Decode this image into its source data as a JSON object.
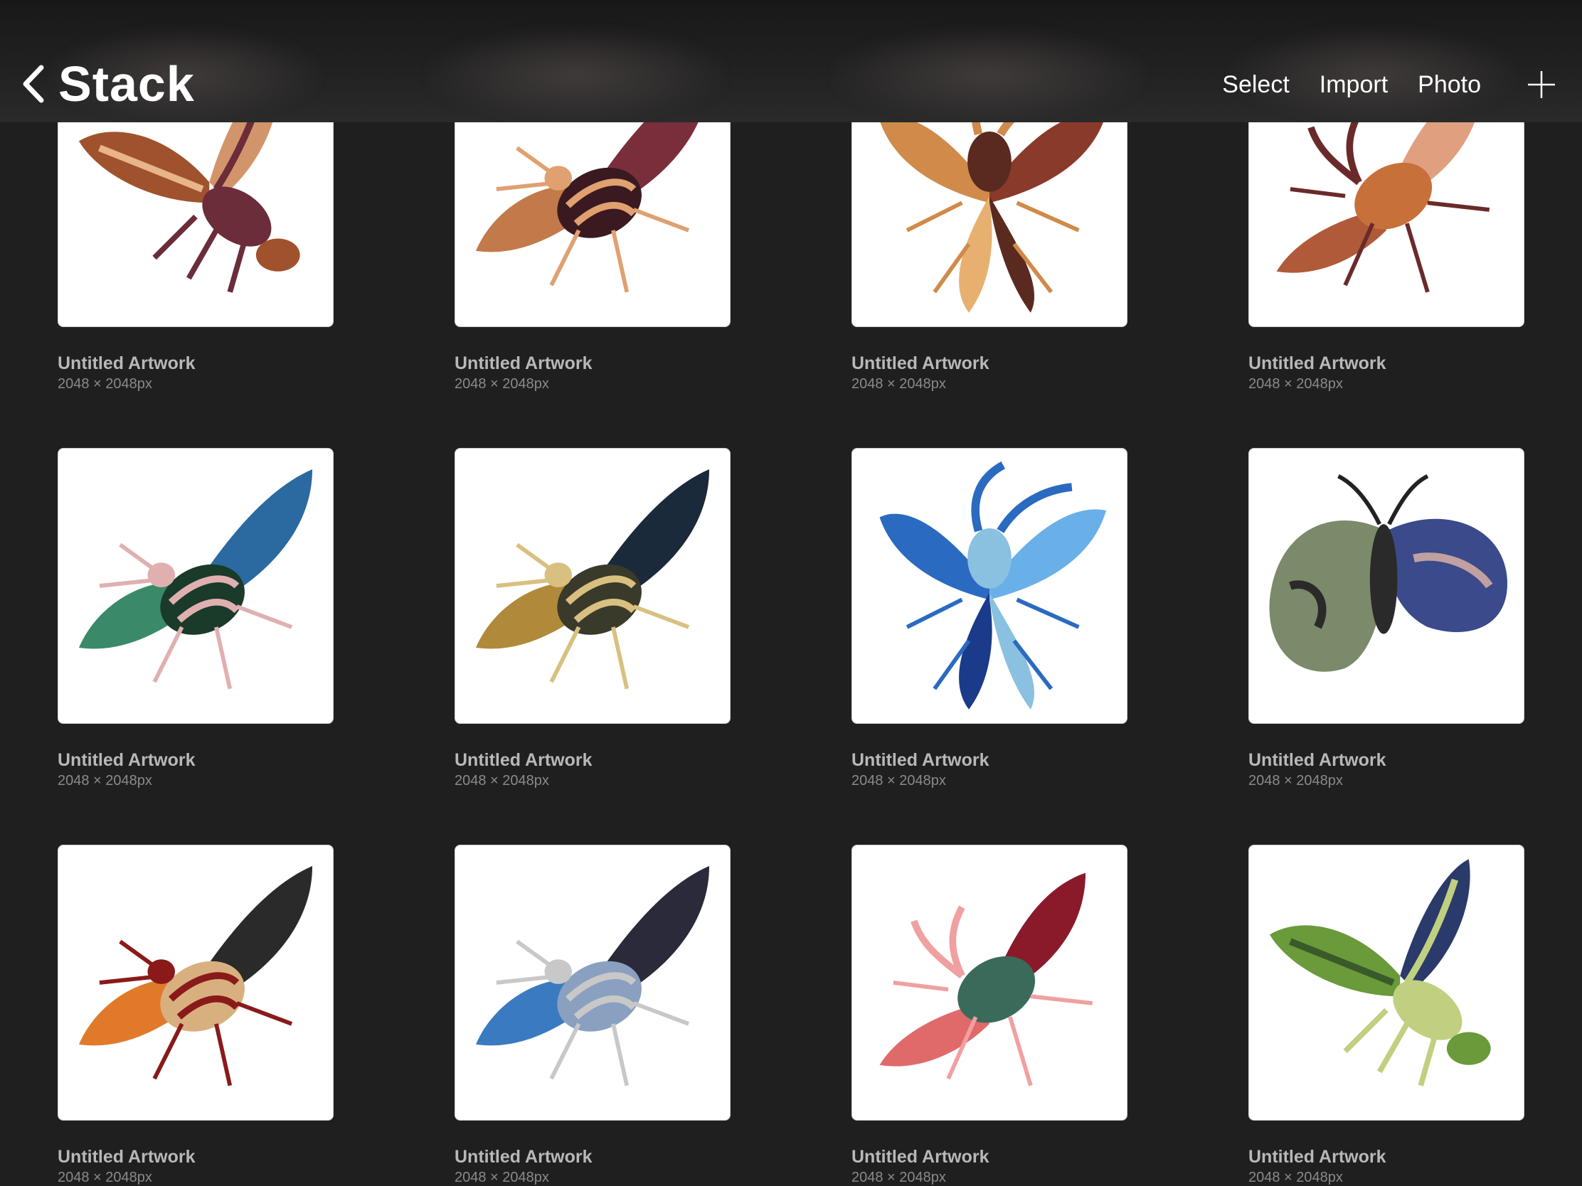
{
  "header": {
    "title": "Stack",
    "actions": [
      "Select",
      "Import",
      "Photo"
    ]
  },
  "artworks": [
    {
      "name": "Untitled Artwork",
      "dims": "2048 × 2048px",
      "palette": [
        "#a0522d",
        "#d2946a",
        "#6b2d3a",
        "#e8b48a"
      ],
      "icon": "wasp-artwork"
    },
    {
      "name": "Untitled Artwork",
      "dims": "2048 × 2048px",
      "palette": [
        "#c27a4a",
        "#7a2e3c",
        "#e0a070",
        "#3a1a20"
      ],
      "icon": "beetle-artwork"
    },
    {
      "name": "Untitled Artwork",
      "dims": "2048 × 2048px",
      "palette": [
        "#d08a4a",
        "#8a3a2a",
        "#e8b070",
        "#5a2a20"
      ],
      "icon": "stag-beetle-artwork"
    },
    {
      "name": "Untitled Artwork",
      "dims": "2048 × 2048px",
      "palette": [
        "#b05a3a",
        "#e0a080",
        "#6a2a2a",
        "#c8703a"
      ],
      "icon": "rhino-beetle-artwork"
    },
    {
      "name": "Untitled Artwork",
      "dims": "2048 × 2048px",
      "palette": [
        "#3a8a6a",
        "#2a6aa0",
        "#e0b0b0",
        "#1a3a2a"
      ],
      "icon": "beetle-artwork"
    },
    {
      "name": "Untitled Artwork",
      "dims": "2048 × 2048px",
      "palette": [
        "#b08a3a",
        "#1a2a3a",
        "#d8c080",
        "#3a3a2a"
      ],
      "icon": "beetle-artwork"
    },
    {
      "name": "Untitled Artwork",
      "dims": "2048 × 2048px",
      "palette": [
        "#2a6ac0",
        "#6ab0e8",
        "#1a3a8a",
        "#8ac0e0"
      ],
      "icon": "stag-beetle-artwork"
    },
    {
      "name": "Untitled Artwork",
      "dims": "2048 × 2048px",
      "palette": [
        "#7a8a6a",
        "#3a4a8a",
        "#c0a0a0",
        "#2a2a2a"
      ],
      "icon": "moth-artwork"
    },
    {
      "name": "Untitled Artwork",
      "dims": "2048 × 2048px",
      "palette": [
        "#e07a2a",
        "#2a2a2a",
        "#8a1a1a",
        "#d8b080"
      ],
      "icon": "beetle-artwork"
    },
    {
      "name": "Untitled Artwork",
      "dims": "2048 × 2048px",
      "palette": [
        "#3a7ac0",
        "#2a2a3a",
        "#c8c8c8",
        "#8aa0c0"
      ],
      "icon": "beetle-artwork"
    },
    {
      "name": "Untitled Artwork",
      "dims": "2048 × 2048px",
      "palette": [
        "#e06a6a",
        "#8a1a2a",
        "#f0a0a0",
        "#3a6a5a"
      ],
      "icon": "rhino-beetle-artwork"
    },
    {
      "name": "Untitled Artwork",
      "dims": "2048 × 2048px",
      "palette": [
        "#6a9a3a",
        "#2a3a6a",
        "#c0d080",
        "#3a5a2a"
      ],
      "icon": "wasp-artwork"
    }
  ]
}
